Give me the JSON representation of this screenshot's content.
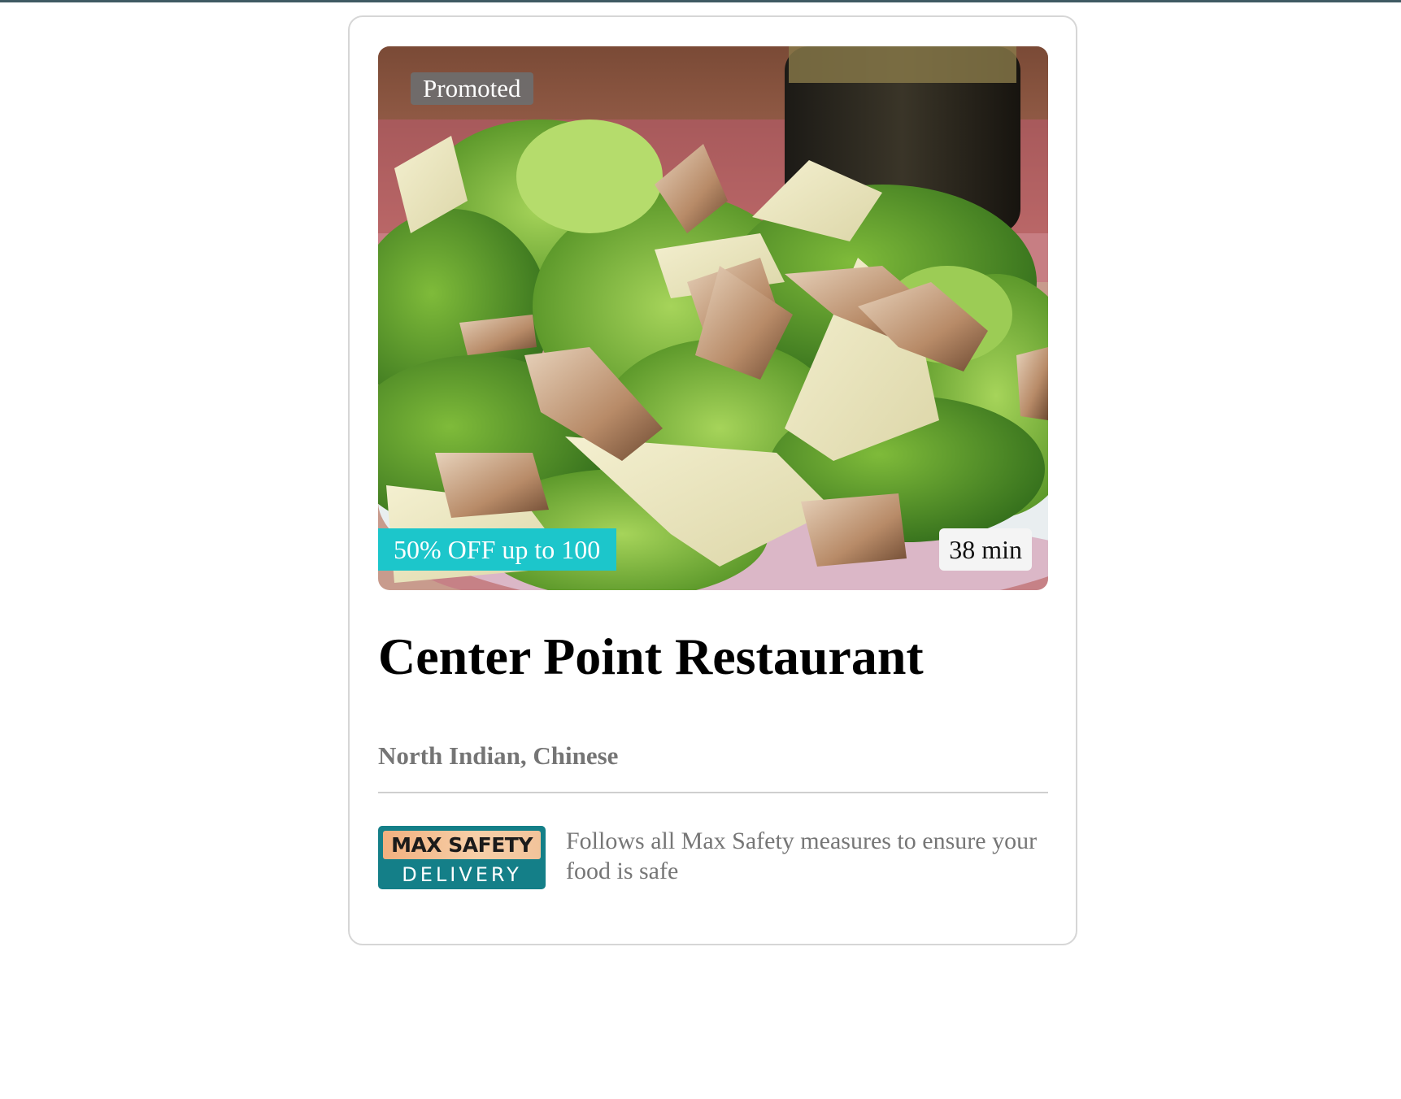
{
  "card": {
    "promoted_label": "Promoted",
    "offer_label": "50% OFF up to 100",
    "delivery_time": "38 min",
    "restaurant_name": "Center Point Restaurant",
    "cuisines": "North Indian, Chinese",
    "image_icon": "salad-photo",
    "safety": {
      "logo_top": "MAX SAFETY",
      "logo_bottom": "DELIVERY",
      "description": "Follows all Max Safety measures to ensure your food is safe"
    }
  },
  "colors": {
    "top_bar": "#3f5a63",
    "offer_badge": "#1cc6cb",
    "safety_logo": "#147f88",
    "muted_text": "#767676"
  }
}
